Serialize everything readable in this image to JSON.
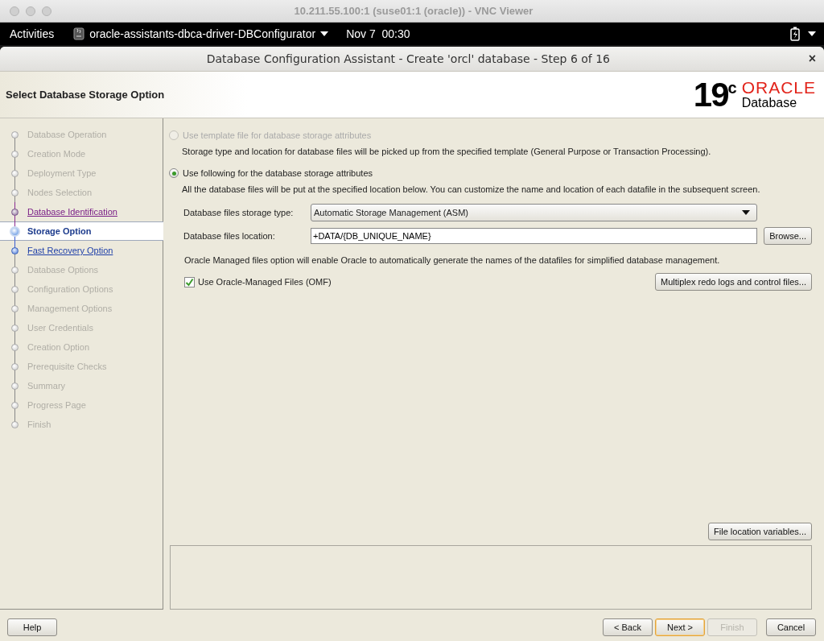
{
  "vnc_window": {
    "title": "10.211.55.100:1 (suse01:1 (oracle)) - VNC Viewer"
  },
  "top_bar": {
    "activities": "Activities",
    "app_menu": "oracle-assistants-dbca-driver-DBConfigurator",
    "clock": "Nov 7  00:30"
  },
  "dialog": {
    "title": "Database Configuration Assistant - Create 'orcl' database - Step 6 of 16",
    "close": "×"
  },
  "header": {
    "title": "Select Database Storage Option",
    "logo_version": "19",
    "logo_superscript": "c",
    "logo_brand": "ORACLE",
    "logo_product": "Database"
  },
  "steps": [
    {
      "label": "Database Operation",
      "kind": "pending",
      "selected": false
    },
    {
      "label": "Creation Mode",
      "kind": "pending",
      "selected": false
    },
    {
      "label": "Deployment Type",
      "kind": "pending",
      "selected": false
    },
    {
      "label": "Nodes Selection",
      "kind": "pending",
      "selected": false
    },
    {
      "label": "Database Identification",
      "kind": "visited",
      "selected": false
    },
    {
      "label": "Storage Option",
      "kind": "current",
      "selected": true
    },
    {
      "label": "Fast Recovery Option",
      "kind": "link",
      "selected": false
    },
    {
      "label": "Database Options",
      "kind": "pending",
      "selected": false
    },
    {
      "label": "Configuration Options",
      "kind": "pending",
      "selected": false
    },
    {
      "label": "Management Options",
      "kind": "pending",
      "selected": false
    },
    {
      "label": "User Credentials",
      "kind": "pending",
      "selected": false
    },
    {
      "label": "Creation Option",
      "kind": "pending",
      "selected": false
    },
    {
      "label": "Prerequisite Checks",
      "kind": "pending",
      "selected": false
    },
    {
      "label": "Summary",
      "kind": "pending",
      "selected": false
    },
    {
      "label": "Progress Page",
      "kind": "pending",
      "selected": false
    },
    {
      "label": "Finish",
      "kind": "pending",
      "selected": false
    }
  ],
  "options": [
    {
      "label": "Use template file for database storage attributes",
      "selected": false,
      "disabled": true,
      "description": "Storage type and location for database files will be picked up from the specified template (General Purpose or Transaction Processing)."
    },
    {
      "label": "Use following for the database storage attributes",
      "selected": true,
      "disabled": false,
      "description": "All the database files will be put at the specified location below. You can customize the name and location of each datafile in the subsequent screen."
    }
  ],
  "storage_type": {
    "label": "Database files storage type:",
    "value": "Automatic Storage Management (ASM)"
  },
  "location": {
    "label": "Database files location:",
    "value": "+DATA/{DB_UNIQUE_NAME}",
    "button": "Browse..."
  },
  "omf_note": "Oracle Managed files option will enable Oracle to automatically generate the names of the datafiles for simplified database management.",
  "omf": {
    "label": "Use Oracle-Managed Files (OMF)",
    "checked": true
  },
  "multiplex_button": "Multiplex redo logs and control files...",
  "file_location_button": "File location variables...",
  "footer": {
    "help": "Help",
    "buttons": [
      {
        "label": "< Back",
        "disabled": false,
        "default": false
      },
      {
        "label": "Next >",
        "disabled": false,
        "default": true
      },
      {
        "label": "Finish",
        "disabled": true,
        "default": false
      },
      {
        "label": "Cancel",
        "disabled": false,
        "default": false
      }
    ]
  }
}
